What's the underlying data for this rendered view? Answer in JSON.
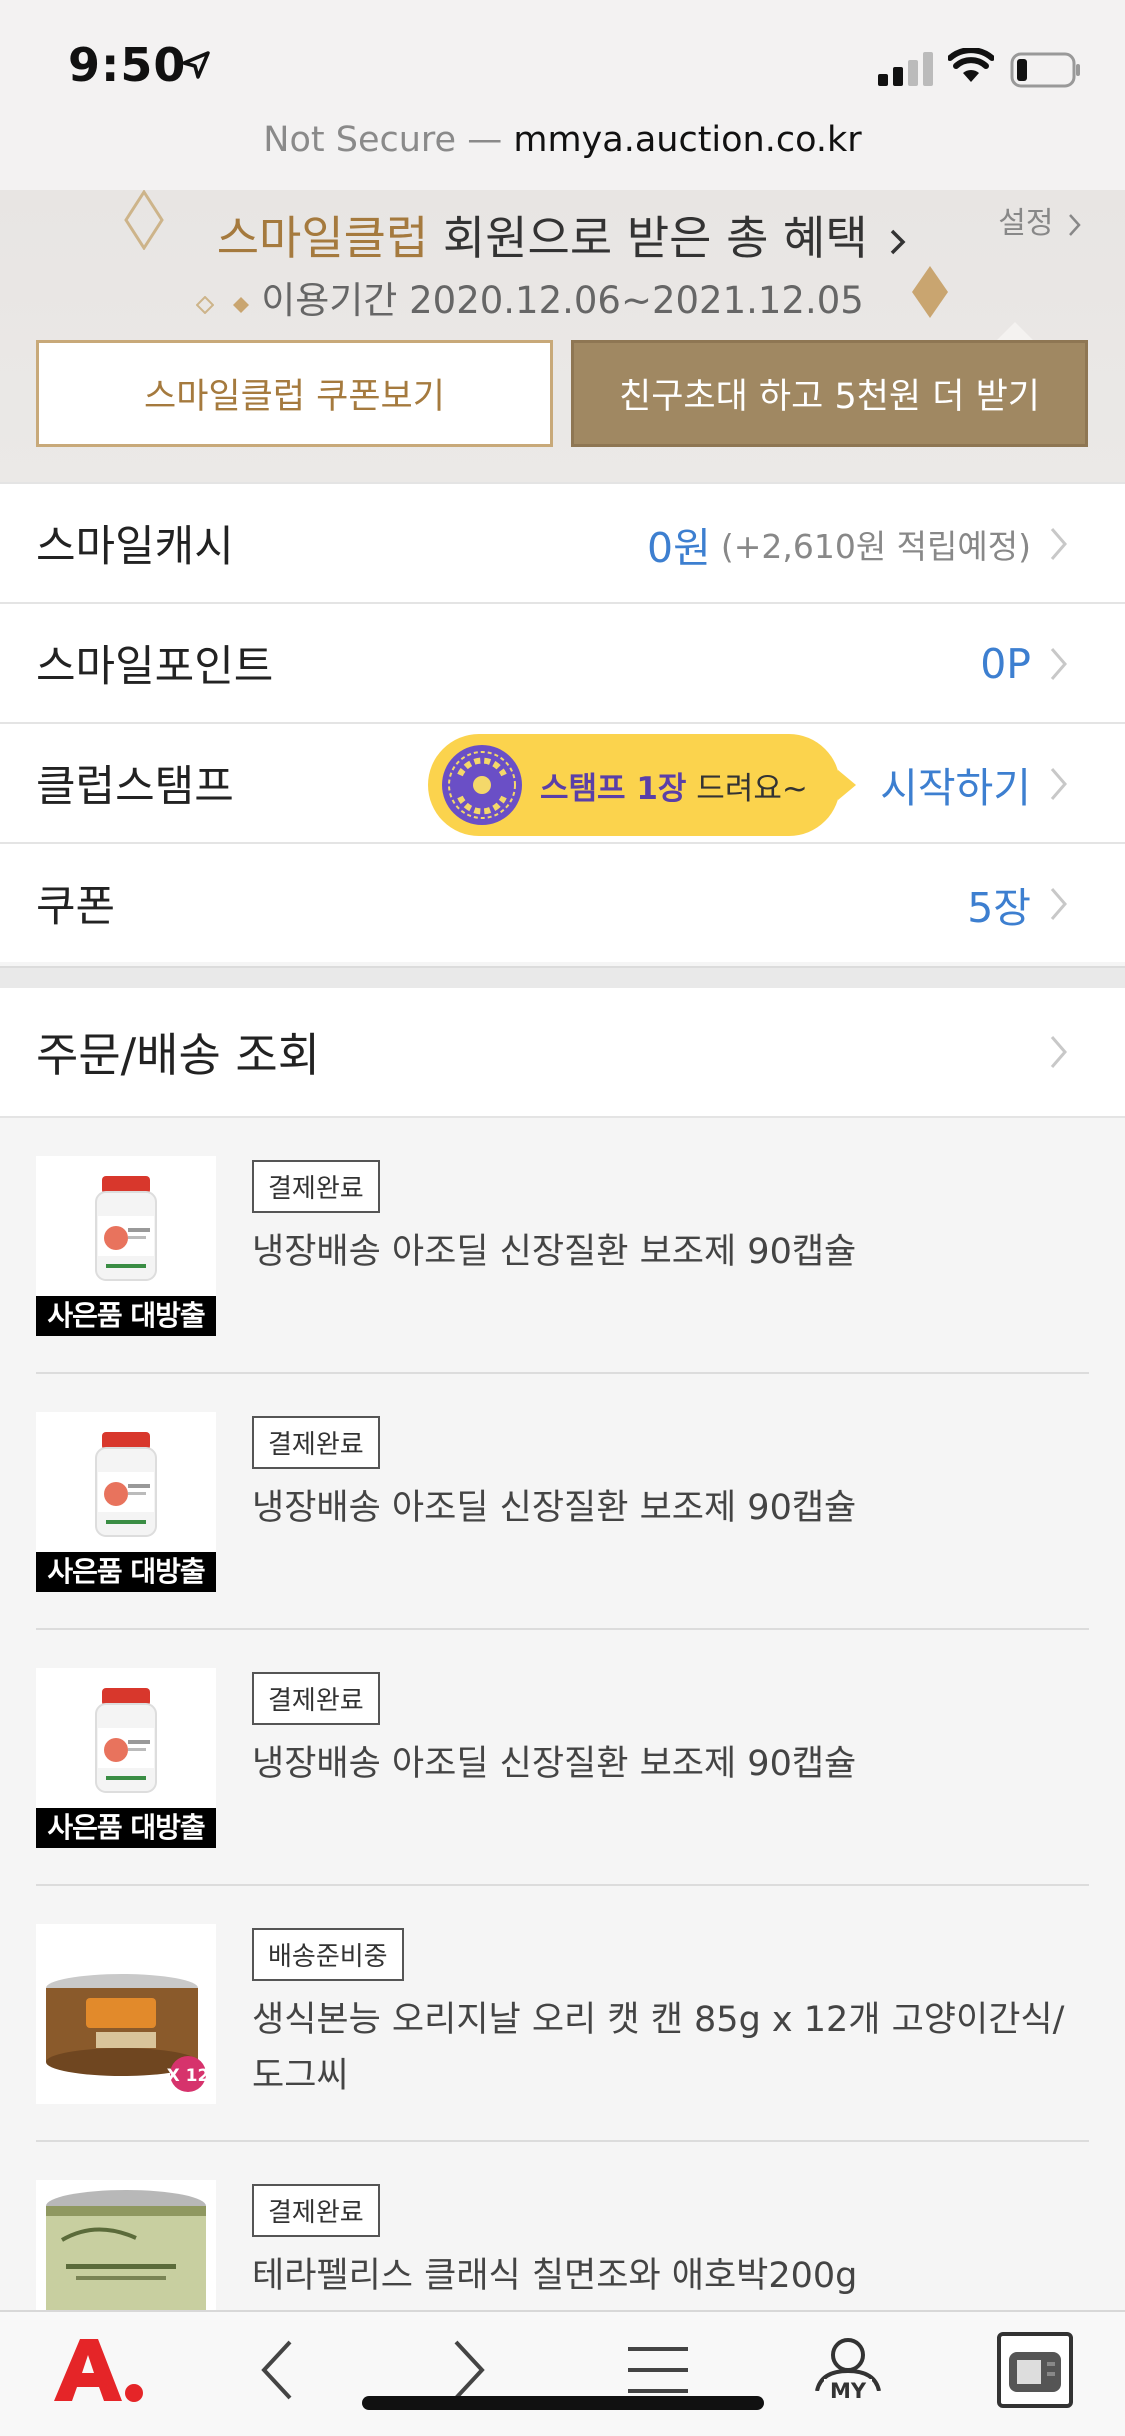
{
  "status_bar": {
    "time": "9:50"
  },
  "url_bar": {
    "prefix": "Not Secure —",
    "host": "mmya.auction.co.kr"
  },
  "banner": {
    "brand": "스마일클럽",
    "title_rest": " 회원으로 받은 총 혜택",
    "settings": "설정",
    "period": "이용기간 2020.12.06~2021.12.05",
    "coupon_button": "스마일클럽 쿠폰보기",
    "invite_button": "친구초대 하고 5천원 더 받기"
  },
  "menu": {
    "smile_cash": {
      "label": "스마일캐시",
      "value": "0원",
      "sub": "(+2,610원 적립예정)"
    },
    "smile_point": {
      "label": "스마일포인트",
      "value": "0P"
    },
    "club_stamp": {
      "label": "클럽스탬프",
      "tooltip_strong": "스탬프 1장",
      "tooltip_rest": " 드려요~",
      "action": "시작하기"
    },
    "coupon": {
      "label": "쿠폰",
      "value": "5장"
    }
  },
  "orders_section": {
    "title": "주문/배송 조회"
  },
  "orders": [
    {
      "status": "결제완료",
      "title": "냉장배송 아조딜 신장질환 보조제 90캡슐",
      "promo": "사은품 대방출",
      "image": "azodyl-bottle"
    },
    {
      "status": "결제완료",
      "title": "냉장배송 아조딜 신장질환 보조제 90캡슐",
      "promo": "사은품 대방출",
      "image": "azodyl-bottle"
    },
    {
      "status": "결제완료",
      "title": "냉장배송 아조딜 신장질환 보조제 90캡슐",
      "promo": "사은품 대방출",
      "image": "azodyl-bottle"
    },
    {
      "status": "배송준비중",
      "title": "생식본능 오리지날 오리 캣 캔 85g x 12개 고양이간식/도그씨",
      "badge": "X 12",
      "image": "instinct-can"
    },
    {
      "status": "결제완료",
      "title": "테라펠리스 클래식 칠면조와 애호박200g",
      "image": "terra-faelis-can"
    }
  ],
  "bottom_bar": {
    "my_label": "MY"
  },
  "colors": {
    "brand_gold": "#a57a3e",
    "accent_blue": "#3d7fd0",
    "stamp_yellow": "#fbd34d",
    "auction_red": "#e52528"
  }
}
